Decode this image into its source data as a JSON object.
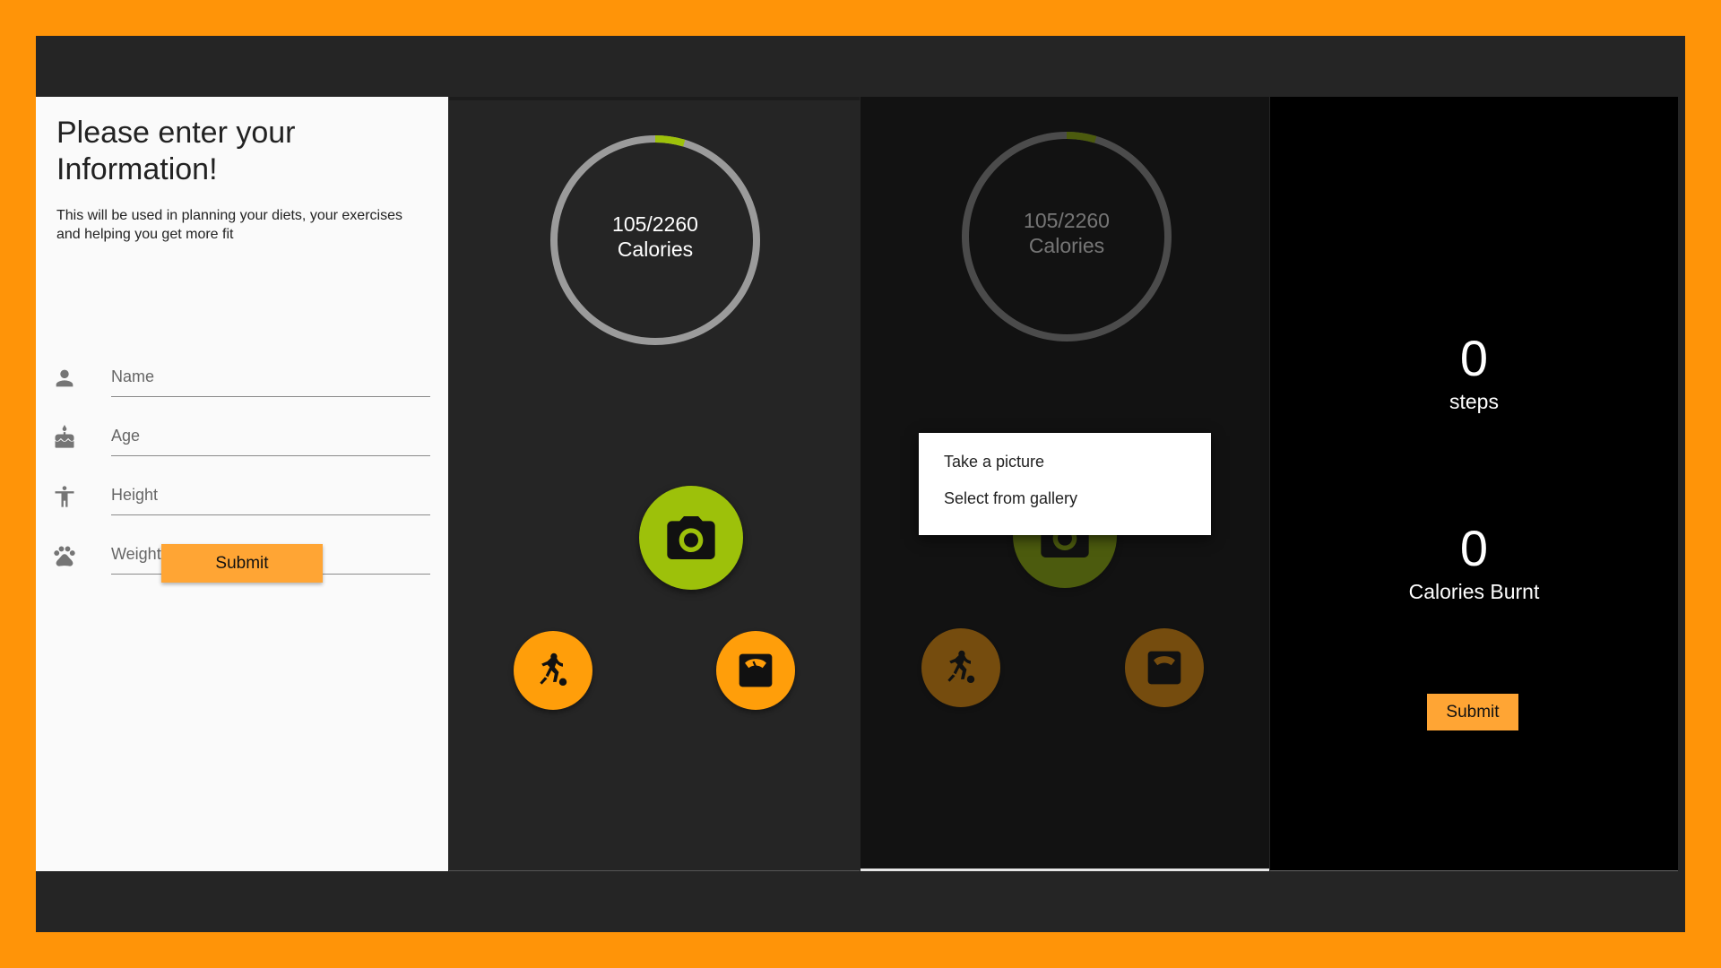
{
  "form": {
    "title": "Please enter your Information!",
    "description": "This will be used in planning your diets, your exercises and helping you get more fit",
    "fields": [
      {
        "placeholder": "Name",
        "icon": "person-icon"
      },
      {
        "placeholder": "Age",
        "icon": "cake-icon"
      },
      {
        "placeholder": "Height",
        "icon": "accessibility-icon"
      },
      {
        "placeholder": "Weight(Current)",
        "icon": "paw-icon"
      }
    ],
    "submit_label": "Submit"
  },
  "dashboard": {
    "calories_value": "105/2260",
    "calories_label": "Calories",
    "progress_fraction": 0.046,
    "camera_icon": "camera-icon",
    "exercise_icon": "soccer-player-icon",
    "scale_icon": "weight-scale-icon"
  },
  "popup": {
    "take_picture": "Take a picture",
    "select_gallery": "Select from gallery"
  },
  "steps": {
    "steps_value": "0",
    "steps_label": "steps",
    "calories_value": "0",
    "calories_label": "Calories Burnt",
    "submit_label": "Submit"
  },
  "colors": {
    "frame_orange": "#FF9408",
    "accent_green": "#9DC10A",
    "accent_orange": "#FF9E0A",
    "button_orange": "#FFA534"
  }
}
